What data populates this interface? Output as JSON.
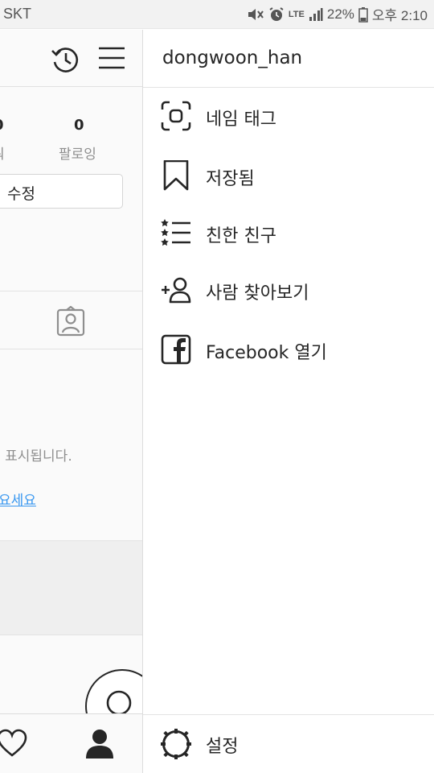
{
  "status_bar": {
    "carrier": "SKT",
    "network": "LTE",
    "battery": "22%",
    "time": "오후 2:10",
    "icons": [
      "mute-icon",
      "alarm-icon",
      "lte-icon",
      "signal-icon",
      "battery-icon"
    ]
  },
  "background_profile": {
    "followers_count": "0",
    "followers_label": "워",
    "following_count": "0",
    "following_label": "팔로잉",
    "edit_button_label": "수정",
    "empty_text": "l 표시됩니다.",
    "link_text": "요세요"
  },
  "drawer": {
    "username": "dongwoon_han",
    "items": [
      {
        "label": "네임 태그",
        "icon": "nametag-icon"
      },
      {
        "label": "저장됨",
        "icon": "bookmark-icon"
      },
      {
        "label": "친한 친구",
        "icon": "close-friends-list-icon"
      },
      {
        "label": "사람 찾아보기",
        "icon": "add-person-icon"
      },
      {
        "label": "Facebook 열기",
        "icon": "facebook-icon"
      }
    ],
    "settings_label": "설정"
  },
  "colors": {
    "text": "#262626",
    "muted": "#8e8e8e",
    "link": "#3897f0",
    "divider": "#e3e3e3"
  }
}
